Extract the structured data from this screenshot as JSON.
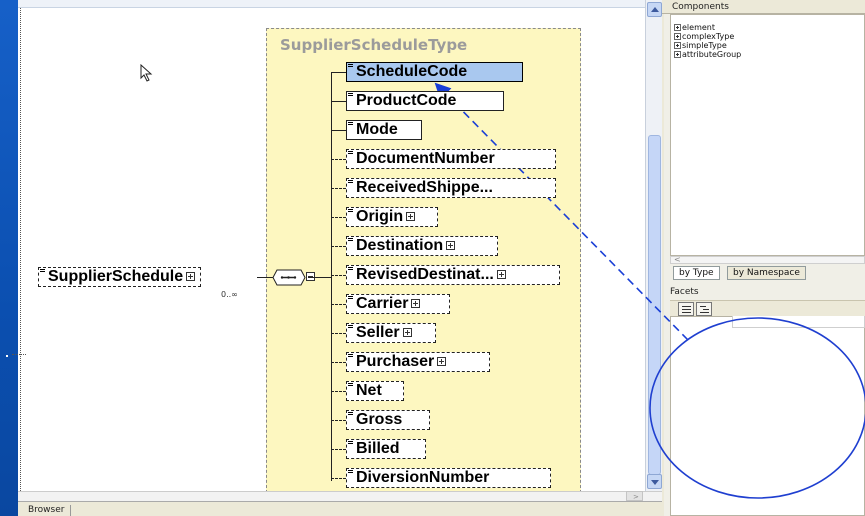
{
  "diagram": {
    "type_name": "SupplierScheduleType",
    "root": {
      "name": "SupplierSchedule",
      "occurrence": "0..∞"
    },
    "children": [
      {
        "name": "ScheduleCode",
        "optional": false,
        "expandable": false,
        "selected": true
      },
      {
        "name": "ProductCode",
        "optional": false,
        "expandable": false,
        "selected": false
      },
      {
        "name": "Mode",
        "optional": false,
        "expandable": false,
        "selected": false
      },
      {
        "name": "DocumentNumber",
        "optional": true,
        "expandable": false,
        "selected": false
      },
      {
        "name": "ReceivedShippe...",
        "optional": true,
        "expandable": false,
        "selected": false
      },
      {
        "name": "Origin",
        "optional": true,
        "expandable": true,
        "selected": false
      },
      {
        "name": "Destination",
        "optional": true,
        "expandable": true,
        "selected": false
      },
      {
        "name": "RevisedDestinat...",
        "optional": true,
        "expandable": true,
        "selected": false
      },
      {
        "name": "Carrier",
        "optional": true,
        "expandable": true,
        "selected": false
      },
      {
        "name": "Seller",
        "optional": true,
        "expandable": true,
        "selected": false
      },
      {
        "name": "Purchaser",
        "optional": true,
        "expandable": true,
        "selected": false
      },
      {
        "name": "Net",
        "optional": true,
        "expandable": false,
        "selected": false
      },
      {
        "name": "Gross",
        "optional": true,
        "expandable": false,
        "selected": false
      },
      {
        "name": "Billed",
        "optional": true,
        "expandable": false,
        "selected": false
      },
      {
        "name": "DiversionNumber",
        "optional": true,
        "expandable": false,
        "selected": false
      }
    ]
  },
  "components": {
    "header": "Components",
    "items": [
      "element",
      "complexType",
      "simpleType",
      "attributeGroup"
    ],
    "tabs": [
      "by Type",
      "by Namespace"
    ]
  },
  "facets": {
    "header": "Facets"
  },
  "bottom_tabs": [
    "Browser"
  ],
  "annotations": {
    "arrow_color": "#1a3fd6",
    "circle_color": "#1f3fd0"
  }
}
